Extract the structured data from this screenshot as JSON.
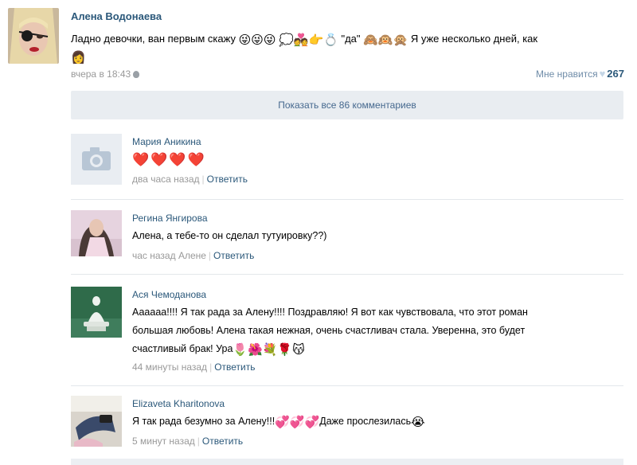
{
  "post": {
    "author": "Алена Водонаева",
    "text_line1": "Ладно девочки, ван первым скажу",
    "text_quote": "\"да\"",
    "text_rest": "Я уже несколько дней, как",
    "time": "вчера в 18:43",
    "like_label": "Мне нравится",
    "like_count": "267"
  },
  "show_all_label": "Показать все 86 комментариев",
  "comments": [
    {
      "author": "Мария Аникина",
      "text": "",
      "time": "два часа назад",
      "reply_label": "Ответить"
    },
    {
      "author": "Регина Янгирова",
      "text": "Алена, а тебе-то он сделал тутуировку??)",
      "time": "час назад Алене",
      "reply_label": "Ответить"
    },
    {
      "author": "Ася Чемоданова",
      "text_line1": "Аааааа!!!! Я так рада за Алену!!!! Поздравляю! Я вот как чувствовала, что этот роман",
      "text_line2": "большая любовь! Алена такая нежная, очень счастливач стала. Уверенна, это будет",
      "text_line3": "счастливый брак! Ура",
      "time": "44 минуты назад",
      "reply_label": "Ответить"
    },
    {
      "author": "Elizaveta Kharitonova",
      "text_part1": "Я так рада безумно за Алену!!!",
      "text_part2": "Даже прослезилась",
      "time": "5 минут назад",
      "reply_label": "Ответить"
    }
  ],
  "icons": {
    "camera": "camera-icon",
    "apple": "apple-icon",
    "heart": "heart-icon"
  },
  "colors": {
    "link": "#2b587a",
    "meta": "#999999",
    "show_all_bg": "#e9edf1"
  }
}
